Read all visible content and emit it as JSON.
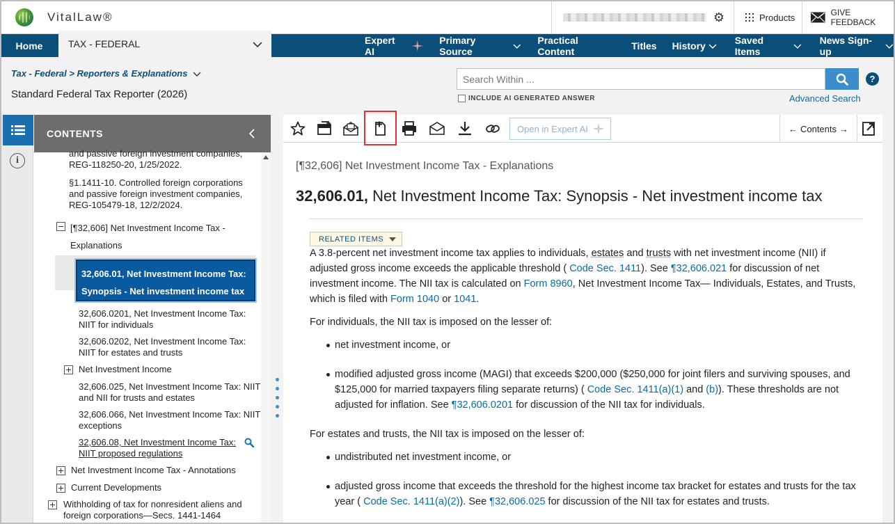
{
  "app": {
    "logo_text": "VitalLaw®"
  },
  "topbar": {
    "products_label": "Products",
    "feedback_label": "GIVE FEEDBACK"
  },
  "nav": {
    "home_label": "Home",
    "library_label": "TAX - FEDERAL",
    "items": [
      {
        "label": "Expert AI",
        "has_chevron": false
      },
      {
        "label": "Primary Source",
        "has_chevron": true
      },
      {
        "label": "Practical Content",
        "has_chevron": false
      },
      {
        "label": "Titles",
        "has_chevron": false
      },
      {
        "label": "History",
        "has_chevron": true
      },
      {
        "label": "Saved Items",
        "has_chevron": true
      },
      {
        "label": "News Sign-up",
        "has_chevron": true
      }
    ]
  },
  "header": {
    "breadcrumb": "Tax - Federal > Reporters & Explanations",
    "doc_title": "Standard Federal Tax Reporter (2026)",
    "search_placeholder": "Search Within ...",
    "ai_checkbox_label": "INCLUDE AI GENERATED ANSWER",
    "advanced_search_label": "Advanced Search"
  },
  "contents": {
    "header": "CONTENTS",
    "items": [
      {
        "lines": [
          "and passive foreign investment companies,",
          "REG-118250-20, 1/25/2022."
        ]
      },
      {
        "lines": [
          "§1.1411-10. Controlled foreign corporations",
          "and passive foreign investment companies,",
          "REG-105479-18, 12/2/2024."
        ]
      },
      {
        "lines": [
          "[¶32,606] Net Investment Income Tax -",
          "Explanations"
        ],
        "expanded": true
      },
      {
        "lines": [
          "32,606.01, Net Investment Income Tax:",
          "Synopsis - Net investment income tax"
        ],
        "selected": true
      },
      {
        "lines": [
          "32,606.0201, Net Investment Income Tax:",
          "NIIT for individuals"
        ]
      },
      {
        "lines": [
          "32,606.0202, Net Investment Income Tax:",
          "NIIT for estates and trusts"
        ]
      },
      {
        "lines": [
          "Net Investment Income"
        ],
        "collapsed": true
      },
      {
        "lines": [
          "32,606.025, Net Investment Income Tax: NIIT",
          "and NII for trusts and estates"
        ]
      },
      {
        "lines": [
          "32,606.066, Net Investment Income Tax: NIIT",
          "exceptions"
        ]
      },
      {
        "lines": [
          "32,606.08, Net Investment Income Tax:",
          "NIIT proposed regulations"
        ],
        "link": true
      },
      {
        "lines": [
          "Net Investment Income Tax - Annotations"
        ],
        "collapsed": true
      },
      {
        "lines": [
          "Current Developments"
        ],
        "collapsed": true
      },
      {
        "lines": [
          "Withholding of tax for nonresident aliens and",
          "foreign corporations—Secs. 1441-1464"
        ],
        "collapsed": true
      }
    ]
  },
  "toolbar": {
    "expert_ai_label": "Open in Expert AI",
    "contents_nav_label": "Contents",
    "highlighted_tool": "add-document-icon"
  },
  "document": {
    "para_ref": "[¶32,606] Net Investment Income Tax - Explanations",
    "heading_num": "32,606.01,",
    "heading_text": "Net Investment Income Tax: Synopsis - Net investment income tax",
    "related_label": "RELATED ITEMS",
    "p1": {
      "a": "A 3.8-percent net investment income tax applies to individuals, ",
      "estates": "estates",
      "b": " and ",
      "trusts": "trusts",
      "c": " with net investment income (NII) if adjusted gross income exceeds the applicable threshold ( ",
      "code1411": "Code Sec. 1411",
      "d": "). See ",
      "ref021": "¶32,606.021",
      "e": " for discussion of net investment income. The NII tax is calculated on ",
      "form8960": "Form 8960",
      "f": ", Net Investment Income Tax— Individuals, Estates, and Trusts, which is filed with ",
      "form1040": "Form 1040",
      "g": " or ",
      "f1041": "1041",
      "h": "."
    },
    "p2": "For individuals, the NII tax is imposed on the lesser of:",
    "b1": "net investment income, or",
    "b2": {
      "a": "modified adjusted gross income (MAGI) that exceeds $200,000 ($250,000 for joint filers and surviving spouses, and $125,000 for married taxpayers filing separate returns) ( ",
      "code": "Code Sec. 1411(a)(1)",
      "b": " and ",
      "codeb": "(b)",
      "c": "). These thresholds are not adjusted for inflation. See ",
      "ref": "¶32,606.0201",
      "d": " for discussion of the NII tax for individuals."
    },
    "p3": "For estates and trusts, the NII tax is imposed on the lesser of:",
    "b3": "undistributed net investment income, or",
    "b4": {
      "a": "adjusted gross income that exceeds the threshold for the highest income tax bracket for estates and trusts for the tax year ( ",
      "code": "Code Sec. 1411(a)(2)",
      "b": "). See ",
      "ref": "¶32,606.025",
      "c": " for discussion of the NII tax for estates and trusts."
    }
  },
  "colors": {
    "nav_blue": "#0a4f7a",
    "link_blue": "#0a6ba8",
    "selected_blue": "#0a5aa0",
    "highlight_red": "#e03030"
  }
}
